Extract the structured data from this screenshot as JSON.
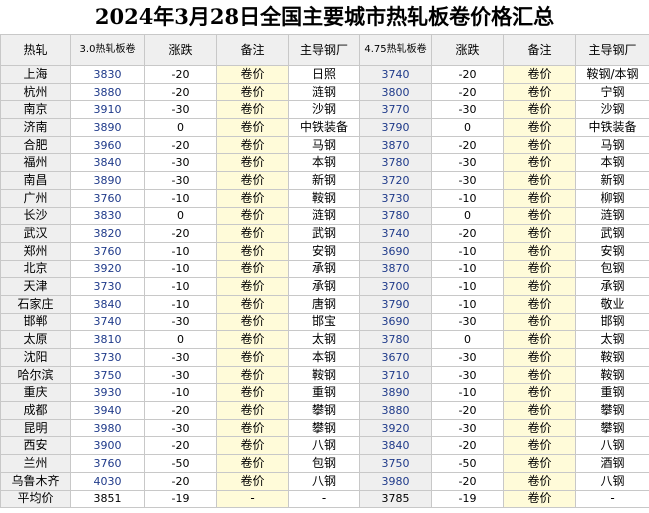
{
  "title": "2024年3月28日全国主要城市热轧板卷价格汇总",
  "headers": [
    "热轧",
    "3.0热轧板卷",
    "涨跌",
    "备注",
    "主导钢厂",
    "4.75热轧板卷",
    "涨跌",
    "备注",
    "主导钢厂"
  ],
  "rows": [
    {
      "city": "上海",
      "p30": "3830",
      "c30": "-20",
      "n30": "卷价",
      "m30": "日照",
      "p475": "3740",
      "c475": "-20",
      "n475": "卷价",
      "m475": "鞍钢/本钢"
    },
    {
      "city": "杭州",
      "p30": "3880",
      "c30": "-20",
      "n30": "卷价",
      "m30": "涟钢",
      "p475": "3800",
      "c475": "-20",
      "n475": "卷价",
      "m475": "宁钢"
    },
    {
      "city": "南京",
      "p30": "3910",
      "c30": "-30",
      "n30": "卷价",
      "m30": "沙钢",
      "p475": "3770",
      "c475": "-30",
      "n475": "卷价",
      "m475": "沙钢"
    },
    {
      "city": "济南",
      "p30": "3890",
      "c30": "0",
      "n30": "卷价",
      "m30": "中铁装备",
      "p475": "3790",
      "c475": "0",
      "n475": "卷价",
      "m475": "中铁装备"
    },
    {
      "city": "合肥",
      "p30": "3960",
      "c30": "-20",
      "n30": "卷价",
      "m30": "马钢",
      "p475": "3870",
      "c475": "-20",
      "n475": "卷价",
      "m475": "马钢"
    },
    {
      "city": "福州",
      "p30": "3840",
      "c30": "-30",
      "n30": "卷价",
      "m30": "本钢",
      "p475": "3780",
      "c475": "-30",
      "n475": "卷价",
      "m475": "本钢"
    },
    {
      "city": "南昌",
      "p30": "3890",
      "c30": "-30",
      "n30": "卷价",
      "m30": "新钢",
      "p475": "3720",
      "c475": "-30",
      "n475": "卷价",
      "m475": "新钢"
    },
    {
      "city": "广州",
      "p30": "3760",
      "c30": "-10",
      "n30": "卷价",
      "m30": "鞍钢",
      "p475": "3730",
      "c475": "-10",
      "n475": "卷价",
      "m475": "柳钢"
    },
    {
      "city": "长沙",
      "p30": "3830",
      "c30": "0",
      "n30": "卷价",
      "m30": "涟钢",
      "p475": "3780",
      "c475": "0",
      "n475": "卷价",
      "m475": "涟钢"
    },
    {
      "city": "武汉",
      "p30": "3820",
      "c30": "-20",
      "n30": "卷价",
      "m30": "武钢",
      "p475": "3740",
      "c475": "-20",
      "n475": "卷价",
      "m475": "武钢"
    },
    {
      "city": "郑州",
      "p30": "3760",
      "c30": "-10",
      "n30": "卷价",
      "m30": "安钢",
      "p475": "3690",
      "c475": "-10",
      "n475": "卷价",
      "m475": "安钢"
    },
    {
      "city": "北京",
      "p30": "3920",
      "c30": "-10",
      "n30": "卷价",
      "m30": "承钢",
      "p475": "3870",
      "c475": "-10",
      "n475": "卷价",
      "m475": "包钢"
    },
    {
      "city": "天津",
      "p30": "3730",
      "c30": "-10",
      "n30": "卷价",
      "m30": "承钢",
      "p475": "3700",
      "c475": "-10",
      "n475": "卷价",
      "m475": "承钢"
    },
    {
      "city": "石家庄",
      "p30": "3840",
      "c30": "-10",
      "n30": "卷价",
      "m30": "唐钢",
      "p475": "3790",
      "c475": "-10",
      "n475": "卷价",
      "m475": "敬业"
    },
    {
      "city": "邯郸",
      "p30": "3740",
      "c30": "-30",
      "n30": "卷价",
      "m30": "邯宝",
      "p475": "3690",
      "c475": "-30",
      "n475": "卷价",
      "m475": "邯钢"
    },
    {
      "city": "太原",
      "p30": "3810",
      "c30": "0",
      "n30": "卷价",
      "m30": "太钢",
      "p475": "3780",
      "c475": "0",
      "n475": "卷价",
      "m475": "太钢"
    },
    {
      "city": "沈阳",
      "p30": "3730",
      "c30": "-30",
      "n30": "卷价",
      "m30": "本钢",
      "p475": "3670",
      "c475": "-30",
      "n475": "卷价",
      "m475": "鞍钢"
    },
    {
      "city": "哈尔滨",
      "p30": "3750",
      "c30": "-30",
      "n30": "卷价",
      "m30": "鞍钢",
      "p475": "3710",
      "c475": "-30",
      "n475": "卷价",
      "m475": "鞍钢"
    },
    {
      "city": "重庆",
      "p30": "3930",
      "c30": "-10",
      "n30": "卷价",
      "m30": "重钢",
      "p475": "3890",
      "c475": "-10",
      "n475": "卷价",
      "m475": "重钢"
    },
    {
      "city": "成都",
      "p30": "3940",
      "c30": "-20",
      "n30": "卷价",
      "m30": "攀钢",
      "p475": "3880",
      "c475": "-20",
      "n475": "卷价",
      "m475": "攀钢"
    },
    {
      "city": "昆明",
      "p30": "3980",
      "c30": "-30",
      "n30": "卷价",
      "m30": "攀钢",
      "p475": "3920",
      "c475": "-30",
      "n475": "卷价",
      "m475": "攀钢"
    },
    {
      "city": "西安",
      "p30": "3900",
      "c30": "-20",
      "n30": "卷价",
      "m30": "八钢",
      "p475": "3840",
      "c475": "-20",
      "n475": "卷价",
      "m475": "八钢"
    },
    {
      "city": "兰州",
      "p30": "3760",
      "c30": "-50",
      "n30": "卷价",
      "m30": "包钢",
      "p475": "3750",
      "c475": "-50",
      "n475": "卷价",
      "m475": "酒钢"
    },
    {
      "city": "乌鲁木齐",
      "p30": "4030",
      "c30": "-20",
      "n30": "卷价",
      "m30": "八钢",
      "p475": "3980",
      "c475": "-20",
      "n475": "卷价",
      "m475": "八钢"
    }
  ],
  "average": {
    "city": "平均价",
    "p30": "3851",
    "c30": "-19",
    "n30": "-",
    "m30": "-",
    "p475": "3785",
    "c475": "-19",
    "n475": "卷价",
    "m475": "-"
  }
}
